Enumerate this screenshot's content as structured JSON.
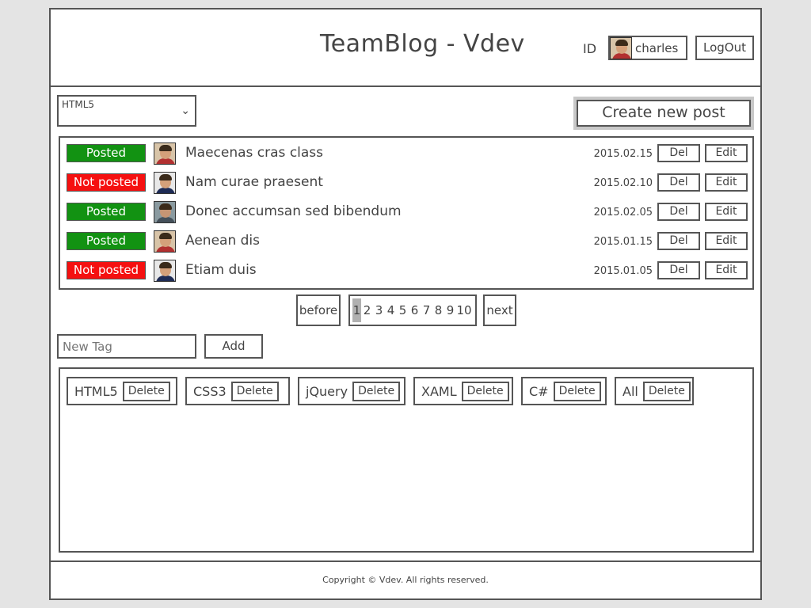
{
  "header": {
    "title": "TeamBlog - Vdev",
    "id_label": "ID",
    "user_name": "charles",
    "logout_label": "LogOut"
  },
  "toolbar": {
    "tag_select_value": "HTML5",
    "create_label": "Create new post"
  },
  "posts": [
    {
      "status": "Posted",
      "status_color": "#129212",
      "title": "Maecenas cras class",
      "date": "2015.02.15",
      "del": "Del",
      "edit": "Edit"
    },
    {
      "status": "Not posted",
      "status_color": "#f51010",
      "title": "Nam curae praesent",
      "date": "2015.02.10",
      "del": "Del",
      "edit": "Edit"
    },
    {
      "status": "Posted",
      "status_color": "#129212",
      "title": "Donec accumsan sed bibendum",
      "date": "2015.02.05",
      "del": "Del",
      "edit": "Edit"
    },
    {
      "status": "Posted",
      "status_color": "#129212",
      "title": "Aenean dis",
      "date": "2015.01.15",
      "del": "Del",
      "edit": "Edit"
    },
    {
      "status": "Not posted",
      "status_color": "#f51010",
      "title": "Etiam duis",
      "date": "2015.01.05",
      "del": "Del",
      "edit": "Edit"
    }
  ],
  "pagination": {
    "before_label": "before",
    "pages": [
      "1",
      "2",
      "3",
      "4",
      "5",
      "6",
      "7",
      "8",
      "9",
      "10"
    ],
    "current_page": "1",
    "next_label": "next"
  },
  "new_tag": {
    "placeholder": "New Tag",
    "add_label": "Add"
  },
  "tags": [
    {
      "name": "HTML5",
      "delete_label": "Delete"
    },
    {
      "name": "CSS3",
      "delete_label": "Delete"
    },
    {
      "name": "jQuery",
      "delete_label": "Delete"
    },
    {
      "name": "XAML",
      "delete_label": "Delete"
    },
    {
      "name": "C#",
      "delete_label": "Delete"
    },
    {
      "name": "All",
      "delete_label": "Delete"
    }
  ],
  "footer": {
    "copyright": "Copyright © Vdev. All rights reserved."
  }
}
